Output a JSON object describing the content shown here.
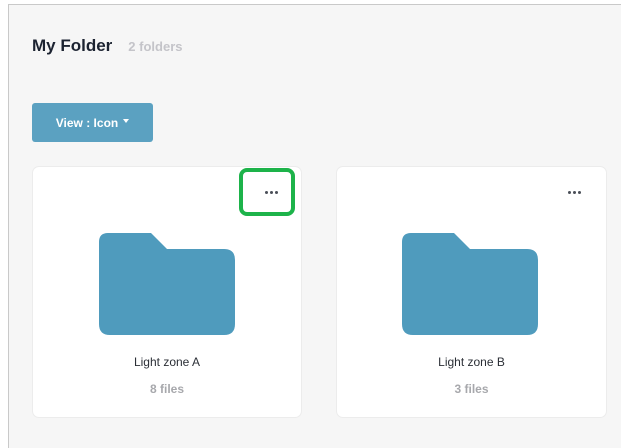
{
  "header": {
    "title": "My Folder",
    "subtitle": "2 folders"
  },
  "view_button": {
    "label": "View : Icon"
  },
  "folders": [
    {
      "name": "Light zone A",
      "count": "8 files",
      "icon": "folder-icon",
      "menu_icon": "more-horizontal-icon",
      "highlighted": true
    },
    {
      "name": "Light zone B",
      "count": "3 files",
      "icon": "folder-icon",
      "menu_icon": "more-horizontal-icon",
      "highlighted": false
    }
  ],
  "colors": {
    "accent": "#5ba1c1",
    "folder": "#4f9bbd",
    "highlight": "#1db34a",
    "title": "#1c2331",
    "muted": "#a7a8ac"
  }
}
